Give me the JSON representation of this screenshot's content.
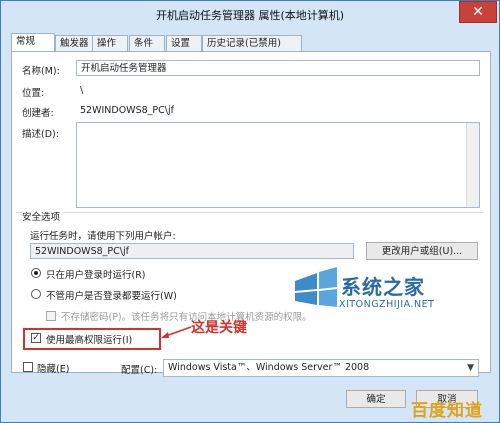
{
  "window": {
    "title": "开机启动任务管理器 属性(本地计算机)",
    "close_symbol": "✕"
  },
  "tabs": [
    "常规",
    "触发器",
    "操作",
    "条件",
    "设置",
    "历史记录(已禁用)"
  ],
  "general": {
    "name_label": "名称(M):",
    "name_value": "开机启动任务管理器",
    "location_label": "位置:",
    "location_value": "\\",
    "author_label": "创建者:",
    "author_value": "52WINDOWS8_PC\\jf",
    "description_label": "描述(D):"
  },
  "security": {
    "section_label": "安全选项",
    "run_as_label": "运行任务时，请使用下列用户帐户:",
    "run_as_value": "52WINDOWS8_PC\\jf",
    "change_user_button": "更改用户或组(U)...",
    "radio_logged_on": "只在用户登录时运行(R)",
    "radio_whether_logged": "不管用户是否登录都要运行(W)",
    "do_not_store_password": "不存储密码(P)。该任务将只有访问本地计算机资源的权限。",
    "highest_privileges": "使用最高权限运行(I)"
  },
  "footer": {
    "hidden_label": "隐藏(E)",
    "configure_label": "配置(C):",
    "configure_value": "Windows Vista™、Windows Server™ 2008",
    "ok_button": "确定",
    "cancel_button": "取消"
  },
  "annotation": {
    "callout_text": "这是关键"
  },
  "watermark": {
    "site_title": "系统之家",
    "site_url": "XITONGZHIJIA.NET",
    "baidu_text": "百度知道"
  },
  "colors": {
    "window_frame": "#d4e6f6",
    "close_button": "#c7423b",
    "highlight": "#d0342c",
    "watermark_blue": "#2a6aa5"
  }
}
